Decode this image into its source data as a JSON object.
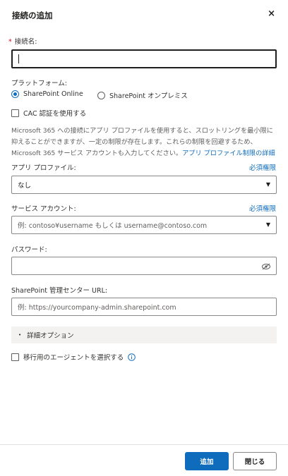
{
  "dialog": {
    "title": "接続の追加",
    "close_label": "×"
  },
  "connection_name": {
    "required_mark": "*",
    "label": "接続名:",
    "value": ""
  },
  "platform": {
    "label": "プラットフォーム:",
    "options": [
      {
        "label": "SharePoint Online",
        "selected": true
      },
      {
        "label": "SharePoint オンプレミス",
        "selected": false
      }
    ]
  },
  "cac": {
    "label": "CAC 認証を使用する",
    "checked": false
  },
  "description": {
    "text": "Microsoft 365 への接続にアプリ プロファイルを使用すると、スロットリングを最小限に抑えることができますが、一定の制限が存在します。これらの制限を回避するため、Microsoft 365 サービス アカウントも入力してください。",
    "link": "アプリ プロファイル制限の詳細"
  },
  "app_profile": {
    "label": "アプリ プロファイル:",
    "link": "必須権限",
    "value": "なし"
  },
  "service_account": {
    "label": "サービス アカウント:",
    "link": "必須権限",
    "placeholder": "例: contoso¥username もしくは username@contoso.com"
  },
  "password": {
    "label": "パスワード:",
    "value": ""
  },
  "admin_url": {
    "label": "SharePoint 管理センター URL:",
    "placeholder": "例: https://yourcompany-admin.sharepoint.com"
  },
  "advanced": {
    "label": "詳細オプション"
  },
  "agent": {
    "label": "移行用のエージェントを選択する",
    "checked": false
  },
  "footer": {
    "add_label": "追加",
    "close_label": "閉じる"
  },
  "colors": {
    "accent": "#0f6cbd",
    "required": "#c50f1f",
    "border": "#8a8886"
  }
}
